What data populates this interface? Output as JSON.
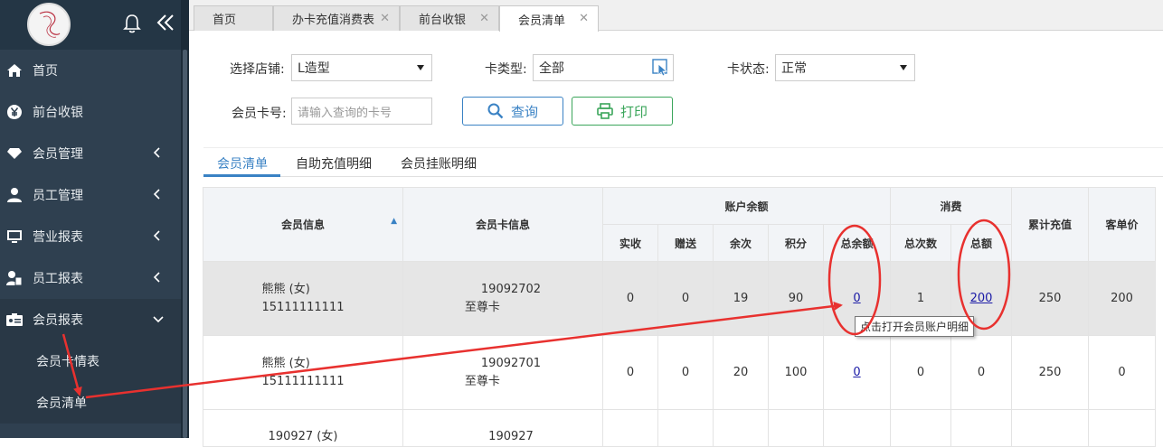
{
  "sidebar": {
    "menu": [
      {
        "label": "首页",
        "icon": "home-icon"
      },
      {
        "label": "前台收银",
        "icon": "yen-icon"
      },
      {
        "label": "会员管理",
        "icon": "diamond-icon"
      },
      {
        "label": "员工管理",
        "icon": "user-icon"
      },
      {
        "label": "营业报表",
        "icon": "monitor-icon"
      },
      {
        "label": "员工报表",
        "icon": "user-file-icon"
      },
      {
        "label": "会员报表",
        "icon": "id-card-icon"
      }
    ],
    "submenu": [
      "会员卡情表",
      "会员清单"
    ]
  },
  "tabs": [
    {
      "label": "首页"
    },
    {
      "label": "办卡充值消费表"
    },
    {
      "label": "前台收银"
    },
    {
      "label": "会员清单"
    }
  ],
  "filters": {
    "store_label": "选择店铺:",
    "store_value": "L造型",
    "card_type_label": "卡类型:",
    "card_type_value": "全部",
    "card_status_label": "卡状态:",
    "card_status_value": "正常",
    "card_no_label": "会员卡号:",
    "card_no_placeholder": "请输入查询的卡号",
    "query_btn": "查询",
    "print_btn": "打印"
  },
  "subtabs": [
    "会员清单",
    "自助充值明细",
    "会员挂账明细"
  ],
  "table": {
    "headers": {
      "member_info": "会员信息",
      "card_info": "会员卡信息",
      "balance_group": "账户余额",
      "consume_group": "消费",
      "cumulative": "累计充值",
      "per_order": "客单价",
      "balance_cols": [
        "实收",
        "赠送",
        "余次",
        "积分",
        "总余额"
      ],
      "consume_cols": [
        "总次数",
        "总额"
      ]
    },
    "rows": [
      {
        "name": "熊熊 (女)",
        "phone": "15111111111",
        "card_no": "19092702",
        "card_type": "至尊卡",
        "paid": "0",
        "gift": "0",
        "times": "19",
        "points": "90",
        "total_balance": "0",
        "consume_times": "1",
        "consume_total": "200",
        "cumulative": "250",
        "per_order": "200"
      },
      {
        "name": "熊熊 (女)",
        "phone": "15111111111",
        "card_no": "19092701",
        "card_type": "至尊卡",
        "paid": "0",
        "gift": "0",
        "times": "20",
        "points": "100",
        "total_balance": "0",
        "consume_times": "0",
        "consume_total": "0",
        "cumulative": "250",
        "per_order": "0"
      },
      {
        "name": "190927 (女)",
        "card_no": "190927"
      }
    ]
  },
  "tooltip": "点击打开会员账户明细",
  "colors": {
    "sidebar_bg": "#2f4050",
    "accent_blue": "#3a82c4",
    "accent_green": "#3aa55a",
    "annotation_red": "#e8312f"
  }
}
